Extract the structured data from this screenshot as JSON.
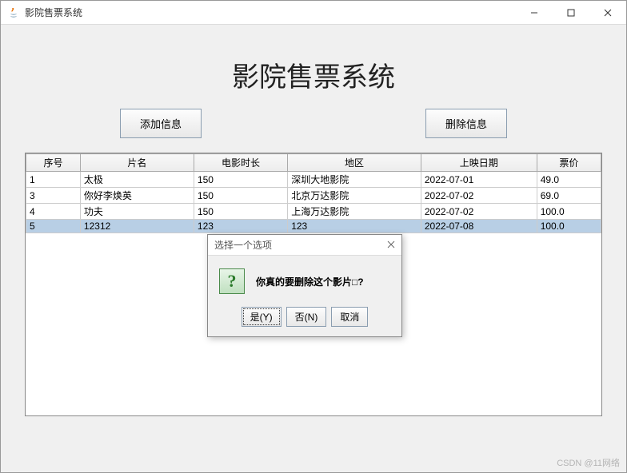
{
  "window": {
    "title": "影院售票系统"
  },
  "heading": "影院售票系统",
  "buttons": {
    "add": "添加信息",
    "delete": "删除信息"
  },
  "table": {
    "headers": [
      "序号",
      "片名",
      "电影时长",
      "地区",
      "上映日期",
      "票价"
    ],
    "rows": [
      {
        "seq": "1",
        "name": "太极",
        "dur": "150",
        "region": "深圳大地影院",
        "date": "2022-07-01",
        "price": "49.0",
        "selected": false
      },
      {
        "seq": "3",
        "name": "你好李焕英",
        "dur": "150",
        "region": "北京万达影院",
        "date": "2022-07-02",
        "price": "69.0",
        "selected": false
      },
      {
        "seq": "4",
        "name": "功夫",
        "dur": "150",
        "region": "上海万达影院",
        "date": "2022-07-02",
        "price": "100.0",
        "selected": false
      },
      {
        "seq": "5",
        "name": "12312",
        "dur": "123",
        "region": "123",
        "date": "2022-07-08",
        "price": "100.0",
        "selected": true
      }
    ]
  },
  "dialog": {
    "title": "选择一个选项",
    "message": "你真的要删除这个影片□?",
    "yes": "是(Y)",
    "no": "否(N)",
    "cancel": "取消"
  },
  "watermark": "CSDN @11网络"
}
